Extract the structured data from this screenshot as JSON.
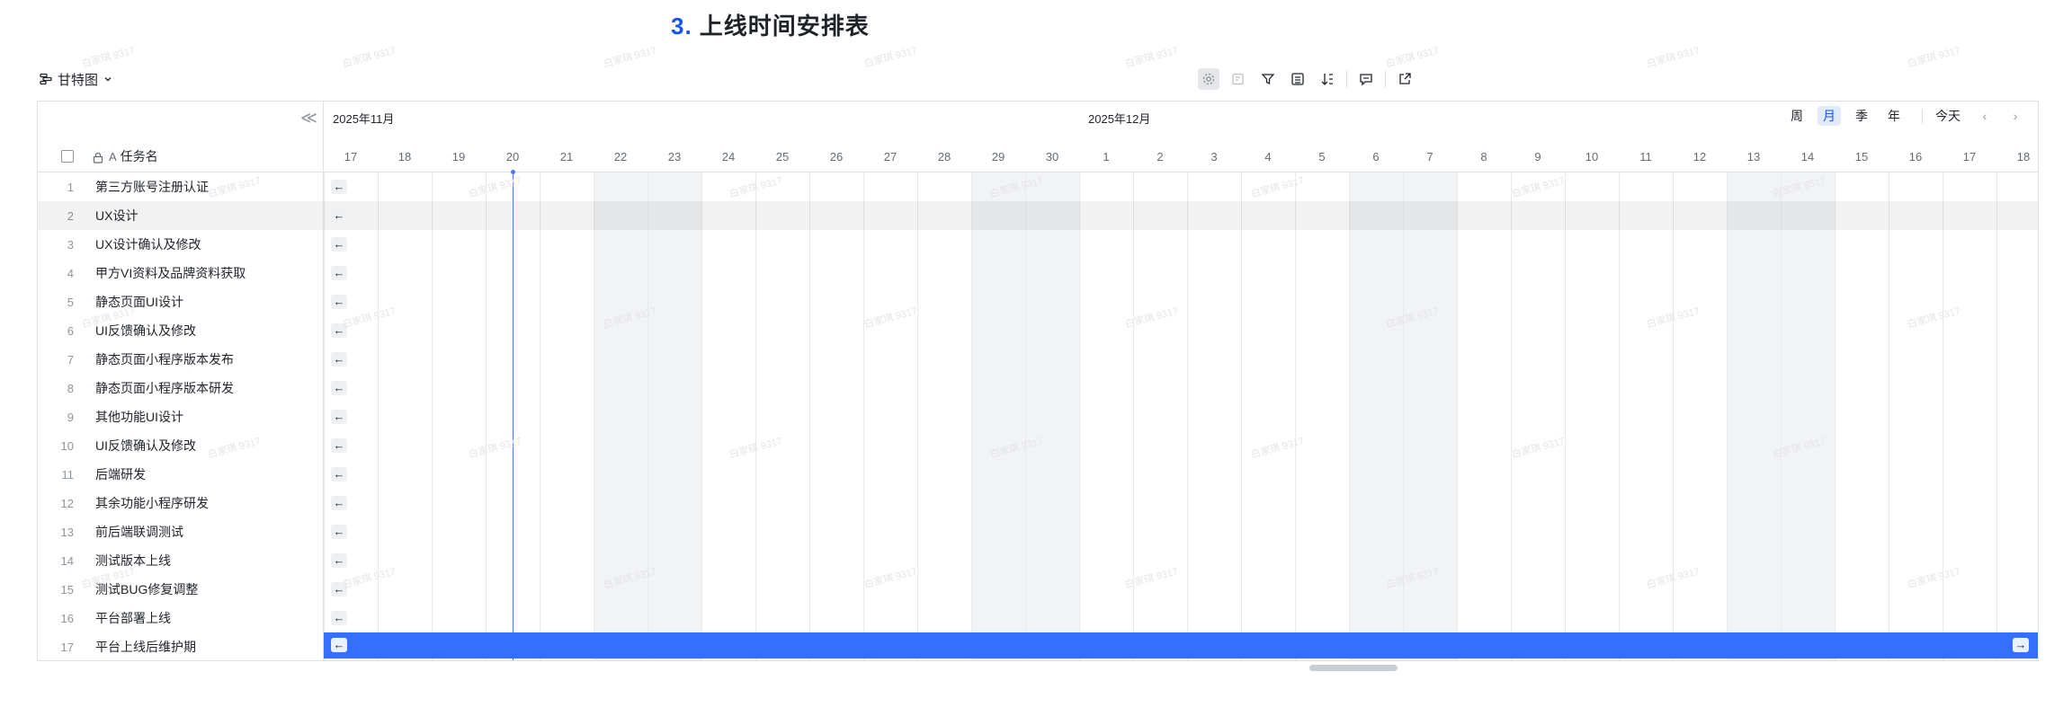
{
  "heading": {
    "number": "3.",
    "title": "上线时间安排表"
  },
  "view": {
    "label": "甘特图",
    "icon": "gantt-icon"
  },
  "toolbar": {
    "icons": [
      "settings-icon",
      "card-icon",
      "filter-icon",
      "fields-icon",
      "sort-icon",
      "comment-icon",
      "share-icon"
    ]
  },
  "left_panel": {
    "header": {
      "sort_glyph": "A",
      "column_title": "任务名"
    },
    "collapse_glyph": "≪"
  },
  "tasks": [
    {
      "index": "1",
      "name": "第三方账号注册认证"
    },
    {
      "index": "2",
      "name": "UX设计"
    },
    {
      "index": "3",
      "name": "UX设计确认及修改"
    },
    {
      "index": "4",
      "name": "甲方VI资料及品牌资料获取"
    },
    {
      "index": "5",
      "name": "静态页面UI设计"
    },
    {
      "index": "6",
      "name": "UI反馈确认及修改"
    },
    {
      "index": "7",
      "name": "静态页面小程序版本发布"
    },
    {
      "index": "8",
      "name": "静态页面小程序版本研发"
    },
    {
      "index": "9",
      "name": "其他功能UI设计"
    },
    {
      "index": "10",
      "name": "UI反馈确认及修改"
    },
    {
      "index": "11",
      "name": "后端研发"
    },
    {
      "index": "12",
      "name": "其余功能小程序研发"
    },
    {
      "index": "13",
      "name": "前后端联调测试"
    },
    {
      "index": "14",
      "name": "测试版本上线"
    },
    {
      "index": "15",
      "name": "测试BUG修复调整"
    },
    {
      "index": "16",
      "name": "平台部署上线"
    },
    {
      "index": "17",
      "name": "平台上线后维护期"
    }
  ],
  "highlighted_row_index": 1,
  "selected_row_index": 16,
  "timeline": {
    "months": [
      {
        "label": "2025年11月",
        "start_day_index": 0
      },
      {
        "label": "2025年12月",
        "start_day_index": 14
      }
    ],
    "days": [
      "17",
      "18",
      "19",
      "20",
      "21",
      "22",
      "23",
      "24",
      "25",
      "26",
      "27",
      "28",
      "29",
      "30",
      "1",
      "2",
      "3",
      "4",
      "5",
      "6",
      "7",
      "8",
      "9",
      "10",
      "11",
      "12",
      "13",
      "14",
      "15",
      "16",
      "17",
      "18"
    ],
    "weekend_day_indices": [
      5,
      6,
      12,
      13,
      19,
      20,
      26,
      27
    ],
    "today_day_index": 3,
    "scale_options": [
      "周",
      "月",
      "季",
      "年"
    ],
    "active_scale": "月",
    "today_label": "今天",
    "prev_glyph": "‹",
    "next_glyph": "›"
  },
  "row_arrow_glyph": "←",
  "selected_row_end_glyph": "→",
  "watermark_text": "白家琪 9317"
}
